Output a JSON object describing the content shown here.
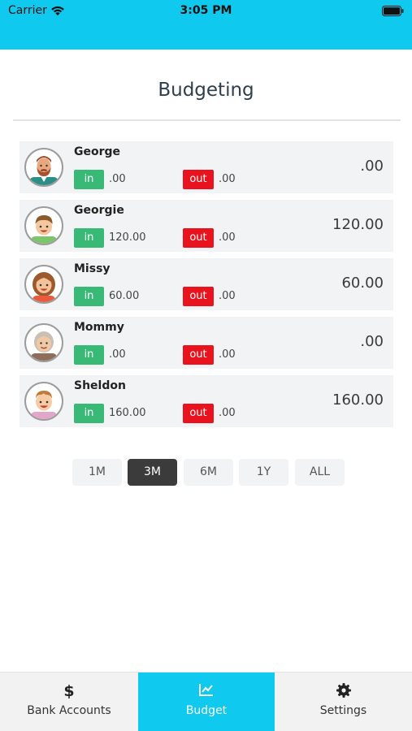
{
  "status_bar": {
    "carrier": "Carrier",
    "time": "3:05 PM"
  },
  "header": {
    "title": "Budgeting"
  },
  "labels": {
    "in": "in",
    "out": "out"
  },
  "people": [
    {
      "name": "George",
      "in": ".00",
      "out": ".00",
      "total": ".00"
    },
    {
      "name": "Georgie",
      "in": "120.00",
      "out": ".00",
      "total": "120.00"
    },
    {
      "name": "Missy",
      "in": "60.00",
      "out": ".00",
      "total": "60.00"
    },
    {
      "name": "Mommy",
      "in": ".00",
      "out": ".00",
      "total": ".00"
    },
    {
      "name": "Sheldon",
      "in": "160.00",
      "out": ".00",
      "total": "160.00"
    }
  ],
  "periods": [
    "1M",
    "3M",
    "6M",
    "1Y",
    "ALL"
  ],
  "selected_period": "3M",
  "tabs": [
    {
      "label": "Bank Accounts",
      "icon": "dollar-icon"
    },
    {
      "label": "Budget",
      "icon": "chart-icon"
    },
    {
      "label": "Settings",
      "icon": "gear-icon"
    }
  ],
  "active_tab": "Budget",
  "colors": {
    "accent": "#10c9ee",
    "in": "#39b976",
    "out": "#e8131c",
    "selected_period": "#3b3b3b"
  }
}
